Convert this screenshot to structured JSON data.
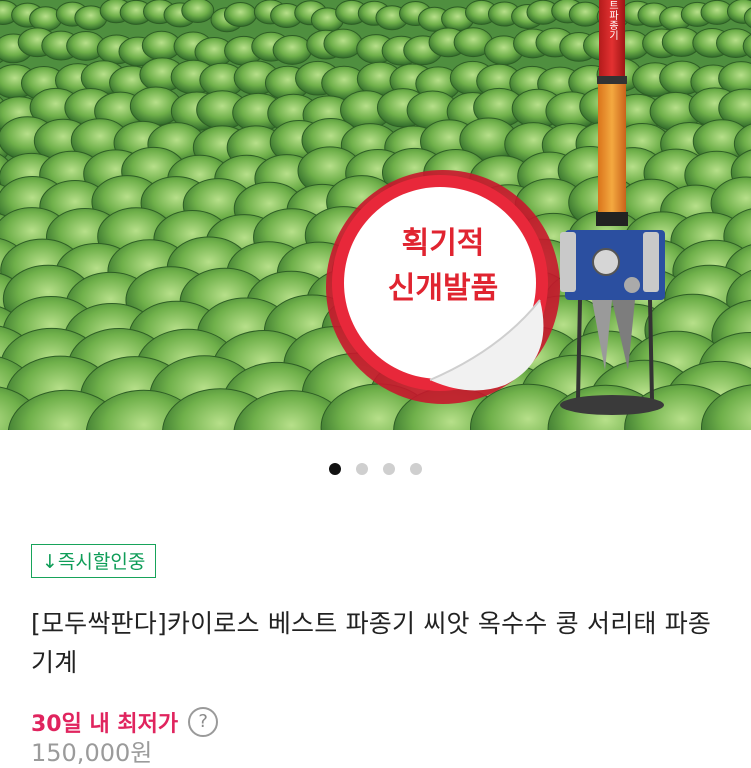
{
  "hero": {
    "promo_line1": "획기적",
    "promo_line2": "신개발품",
    "pole_text": "베스트파종기"
  },
  "carousel": {
    "count": 4,
    "active_index": 0
  },
  "badge": {
    "label": "↓즉시할인중"
  },
  "product": {
    "title": "[모두싹판다]카이로스 베스트 파종기 씨앗 옥수수 콩 서리태 파종기계"
  },
  "lowest_price": {
    "label": "30일 내 최저가",
    "help": "?"
  },
  "price": {
    "value": "150,000원"
  },
  "colors": {
    "accent_red": "#e0245e",
    "badge_green": "#0f9d58",
    "promo_red": "#e8283a"
  }
}
